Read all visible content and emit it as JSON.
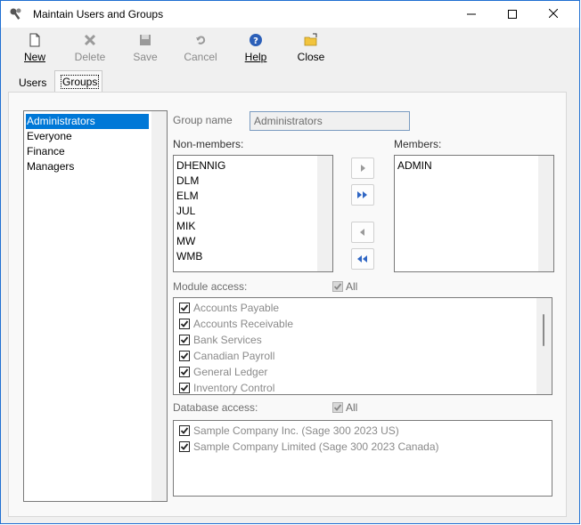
{
  "window": {
    "title": "Maintain Users and Groups"
  },
  "toolbar": {
    "new": "New",
    "delete": "Delete",
    "save": "Save",
    "cancel": "Cancel",
    "help": "Help",
    "close": "Close"
  },
  "tabs": {
    "users": "Users",
    "groups": "Groups"
  },
  "groups": [
    "Administrators",
    "Everyone",
    "Finance",
    "Managers"
  ],
  "selected_group": "Administrators",
  "form": {
    "group_name_label": "Group name",
    "group_name_value": "Administrators",
    "non_members_label": "Non-members:",
    "members_label": "Members:",
    "non_members": [
      "DHENNIG",
      "DLM",
      "ELM",
      "JUL",
      "MIK",
      "MW",
      "WMB"
    ],
    "members": [
      "ADMIN"
    ],
    "module_access_label": "Module access:",
    "module_all_label": "All",
    "modules": [
      "Accounts Payable",
      "Accounts Receivable",
      "Bank Services",
      "Canadian Payroll",
      "General Ledger",
      "Inventory Control"
    ],
    "database_access_label": "Database access:",
    "database_all_label": "All",
    "databases": [
      "Sample Company Inc. (Sage 300 2023 US)",
      "Sample Company Limited (Sage 300 2023 Canada)"
    ]
  },
  "colors": {
    "accent": "#0078d7",
    "title_border": "#1f6fd1"
  },
  "icons": [
    "app-icon",
    "minimize-icon",
    "maximize-icon",
    "close-icon",
    "new-icon",
    "delete-icon",
    "save-icon",
    "cancel-icon",
    "help-icon",
    "close-folder-icon",
    "arrow-right-icon",
    "double-arrow-right-icon",
    "arrow-left-icon",
    "double-arrow-left-icon",
    "checkbox-icon"
  ]
}
